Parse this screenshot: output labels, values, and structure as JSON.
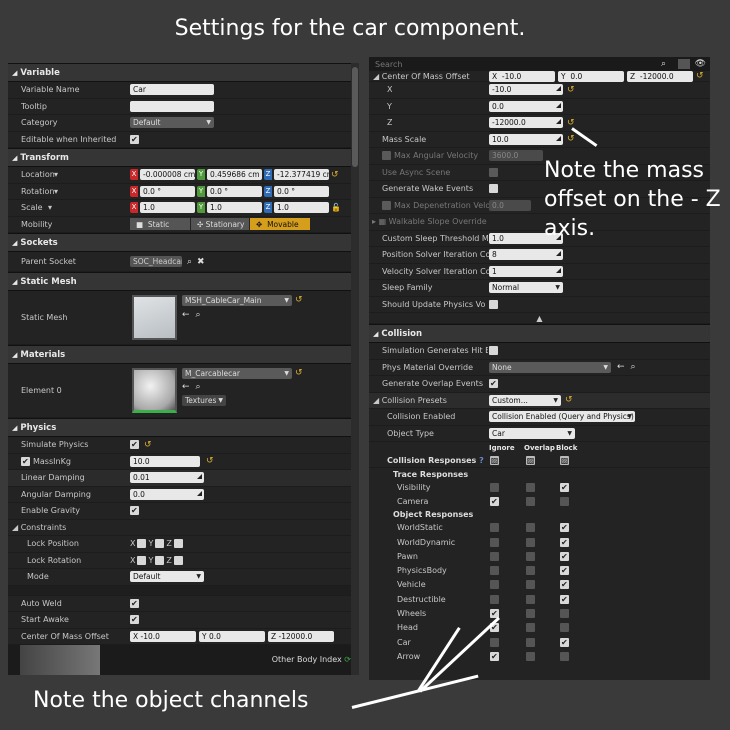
{
  "captions": {
    "top": "Settings for the car component.",
    "mass_note": "Note the mass offset on the - Z axis.",
    "object_note": "Note the object channels"
  },
  "left": {
    "variable": {
      "header": "Variable",
      "name_label": "Variable Name",
      "name_value": "Car",
      "tooltip_label": "Tooltip",
      "category_label": "Category",
      "category_value": "Default",
      "editable_label": "Editable when Inherited"
    },
    "transform": {
      "header": "Transform",
      "location_label": "Location",
      "location": [
        "-0.000008 cm",
        "0.459686 cm",
        "-12.377419 cr"
      ],
      "rotation_label": "Rotation",
      "rotation": [
        "0.0 °",
        "0.0 °",
        "0.0 °"
      ],
      "scale_label": "Scale",
      "scale": [
        "1.0",
        "1.0",
        "1.0"
      ],
      "mobility_label": "Mobility",
      "mobility_static": "Static",
      "mobility_stationary": "Stationary",
      "mobility_movable": "Movable"
    },
    "sockets": {
      "header": "Sockets",
      "parent_label": "Parent Socket",
      "parent_value": "SOC_Headcar"
    },
    "static_mesh": {
      "header": "Static Mesh",
      "label": "Static Mesh",
      "value": "MSH_CableCar_Main"
    },
    "materials": {
      "header": "Materials",
      "label": "Element 0",
      "value": "M_Carcablecar",
      "textures": "Textures"
    },
    "physics": {
      "header": "Physics",
      "simulate": "Simulate Physics",
      "mass_label": "MassInKg",
      "mass_value": "10.0",
      "lin_damp_label": "Linear Damping",
      "lin_damp": "0.01",
      "ang_damp_label": "Angular Damping",
      "ang_damp": "0.0",
      "gravity_label": "Enable Gravity",
      "constraints": "Constraints",
      "lock_pos": "Lock Position",
      "lock_rot": "Lock Rotation",
      "mode_label": "Mode",
      "mode_value": "Default",
      "auto_weld": "Auto Weld",
      "start_awake": "Start Awake",
      "com_label": "Center Of Mass Offset",
      "com": [
        "-10.0",
        "0.0",
        "-12000.0"
      ]
    },
    "footer": "Other Body Index"
  },
  "right": {
    "search_placeholder": "Search",
    "com_label": "Center Of Mass Offset",
    "com": [
      "-10.0",
      "0.0",
      "-12000.0"
    ],
    "x_label": "X",
    "x": "-10.0",
    "y_label": "Y",
    "y": "0.0",
    "z_label": "Z",
    "z": "-12000.0",
    "mass_scale_label": "Mass Scale",
    "mass_scale": "10.0",
    "max_ang_vel_label": "Max Angular Velocity",
    "max_ang_vel": "3600.0",
    "async_label": "Use Async Scene",
    "wake_label": "Generate Wake Events",
    "max_depen_label": "Max Depenetration Velocity",
    "max_depen": "0.0",
    "walkable_label": "Walkable Slope Override",
    "sleep_thr_label": "Custom Sleep Threshold Multip",
    "sleep_thr": "1.0",
    "pos_iter_label": "Position Solver Iteration Count",
    "pos_iter": "8",
    "vel_iter_label": "Velocity Solver Iteration Count",
    "vel_iter": "1",
    "sleep_family_label": "Sleep Family",
    "sleep_family": "Normal",
    "update_vol_label": "Should Update Physics Volume",
    "collision": {
      "header": "Collision",
      "hit_events": "Simulation Generates Hit Events",
      "phys_mat_label": "Phys Material Override",
      "phys_mat": "None",
      "overlap_events": "Generate Overlap Events",
      "presets_label": "Collision Presets",
      "presets": "Custom...",
      "enabled_label": "Collision Enabled",
      "enabled": "Collision Enabled (Query and Physics)",
      "obj_type_label": "Object Type",
      "obj_type": "Car",
      "col_ignore": "Ignore",
      "col_overlap": "Overlap",
      "col_block": "Block",
      "responses": "Collision Responses",
      "trace": "Trace Responses",
      "object": "Object Responses",
      "channels": [
        {
          "name": "Visibility",
          "state": "block",
          "group": "trace"
        },
        {
          "name": "Camera",
          "state": "ignore",
          "group": "trace"
        },
        {
          "name": "WorldStatic",
          "state": "block",
          "group": "object"
        },
        {
          "name": "WorldDynamic",
          "state": "block",
          "group": "object"
        },
        {
          "name": "Pawn",
          "state": "block",
          "group": "object"
        },
        {
          "name": "PhysicsBody",
          "state": "block",
          "group": "object"
        },
        {
          "name": "Vehicle",
          "state": "block",
          "group": "object"
        },
        {
          "name": "Destructible",
          "state": "block",
          "group": "object"
        },
        {
          "name": "Wheels",
          "state": "ignore",
          "group": "object"
        },
        {
          "name": "Head",
          "state": "ignore",
          "group": "object"
        },
        {
          "name": "Car",
          "state": "block",
          "group": "object"
        },
        {
          "name": "Arrow",
          "state": "ignore",
          "group": "object"
        }
      ]
    }
  }
}
